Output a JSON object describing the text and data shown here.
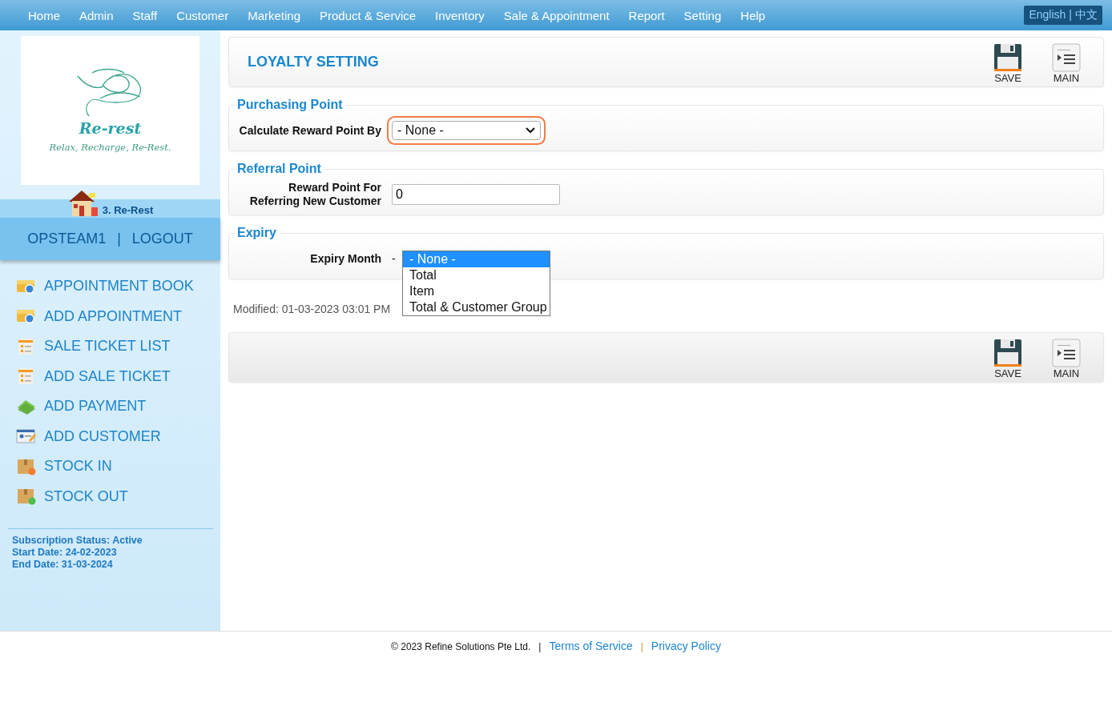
{
  "nav": {
    "items": [
      "Home",
      "Admin",
      "Staff",
      "Customer",
      "Marketing",
      "Product & Service",
      "Inventory",
      "Sale & Appointment",
      "Report",
      "Setting",
      "Help"
    ],
    "language": {
      "english": "English",
      "separator": "|",
      "chinese": "中文"
    }
  },
  "sidebar": {
    "logo": {
      "name": "Re-rest",
      "tagline": "Relax, Recharge, Re-Rest."
    },
    "outlet": "3. Re-Rest",
    "user": "OPSTEAM1",
    "separator": "|",
    "logout": "LOGOUT",
    "menu": [
      "APPOINTMENT BOOK",
      "ADD APPOINTMENT",
      "SALE TICKET LIST",
      "ADD SALE TICKET",
      "ADD PAYMENT",
      "ADD CUSTOMER",
      "STOCK IN",
      "STOCK OUT"
    ],
    "subscription": [
      "Subscription Status: Active",
      "Start Date: 24-02-2023",
      "End Date: 31-03-2024"
    ]
  },
  "page": {
    "title": "LOYALTY SETTING",
    "toolbar": [
      "SAVE",
      "MAIN"
    ],
    "sections": [
      {
        "legend": "Purchasing Point",
        "label": "Calculate Reward Point By",
        "kind": "select",
        "value": "- None -",
        "focused": true
      },
      {
        "legend": "Referral Point",
        "label": "Reward Point For Referring New Customer",
        "kind": "input",
        "value": "0"
      },
      {
        "legend": "Expiry",
        "label": "Expiry Month",
        "kind": "open-select",
        "value": "-",
        "options": [
          {
            "label": "- None -",
            "selected": true
          },
          {
            "label": "Total",
            "selected": false
          },
          {
            "label": "Item",
            "selected": false
          },
          {
            "label": "Total & Customer Group",
            "selected": false
          }
        ]
      }
    ],
    "modified": "Modified: 01-03-2023 03:01 PM",
    "bottom_toolbar": [
      "SAVE",
      "MAIN"
    ]
  },
  "footer": {
    "copyright": "© 2023 Refine Solutions Pte Ltd.",
    "separator_1": "|",
    "terms": "Terms of Service",
    "separator_2": "|",
    "privacy": "Privacy Policy"
  }
}
